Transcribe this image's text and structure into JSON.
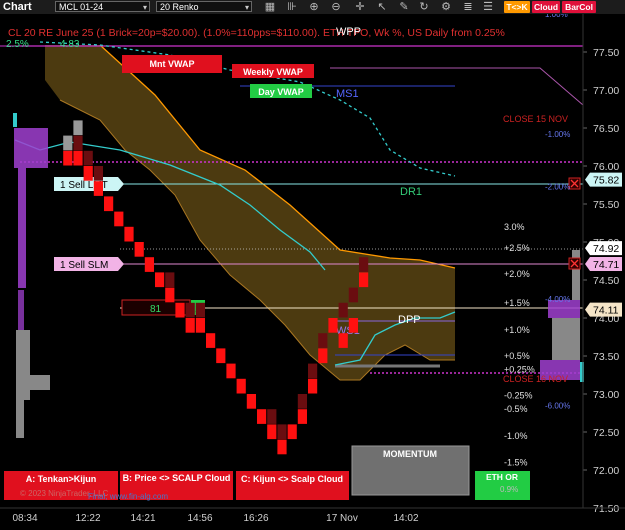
{
  "toolbar": {
    "title": "Chart",
    "symbol": "MCL 01-24",
    "period": "20 Renko",
    "icons": [
      "grid-icon",
      "zoom-in-icon",
      "zoom-out-icon",
      "crosshair-icon",
      "cursor-icon",
      "pencil-icon",
      "reload-icon",
      "settings-icon",
      "stack-icon",
      "list-icon"
    ],
    "buttons": [
      {
        "label": "T<>K",
        "color": "#ff9900"
      },
      {
        "label": "Cloud",
        "color": "#e0103a"
      },
      {
        "label": "BarCol",
        "color": "#e0103a"
      }
    ]
  },
  "chart_data": {
    "type": "renko",
    "header": "CL 20 RE June 25 (1 Brick=20p=$20.00). (1.0%=110pps=$110.00). ETH TPO, Wk %, US Daily from 0.25%",
    "top_left_values": [
      "2.5%",
      "4.83"
    ],
    "ylim": [
      71.5,
      78.0
    ],
    "y_ticks": [
      71.5,
      72.0,
      72.5,
      73.0,
      73.5,
      74.0,
      74.5,
      75.0,
      75.5,
      76.0,
      76.5,
      77.0,
      77.5
    ],
    "x_tick_labels": [
      "08:34",
      "12:22",
      "14:21",
      "14:56",
      "16:26",
      "17 Nov",
      "14:02"
    ],
    "bricks": {
      "red": [
        [
          1,
          76.2
        ],
        [
          2,
          76.2
        ],
        [
          3,
          76.0
        ],
        [
          4,
          75.8
        ],
        [
          5,
          75.6
        ],
        [
          6,
          75.4
        ],
        [
          7,
          75.2
        ],
        [
          8,
          75.0
        ],
        [
          9,
          74.8
        ],
        [
          10,
          74.6
        ],
        [
          11,
          74.4
        ],
        [
          12,
          74.2
        ],
        [
          13,
          74.0
        ],
        [
          14,
          74.0
        ],
        [
          15,
          73.8
        ],
        [
          16,
          73.6
        ],
        [
          17,
          73.4
        ],
        [
          18,
          73.2
        ],
        [
          19,
          73.0
        ],
        [
          20,
          72.8
        ],
        [
          21,
          72.6
        ],
        [
          22,
          72.4
        ],
        [
          23,
          72.6
        ],
        [
          24,
          72.8
        ],
        [
          25,
          73.2
        ],
        [
          26,
          73.6
        ],
        [
          27,
          74.0
        ],
        [
          28,
          73.8
        ],
        [
          29,
          74.0
        ],
        [
          30,
          74.6
        ]
      ],
      "dark_red": [
        [
          2,
          76.4
        ],
        [
          3,
          76.2
        ],
        [
          4,
          76.0
        ],
        [
          11,
          74.6
        ],
        [
          13,
          74.2
        ],
        [
          14,
          74.2
        ],
        [
          21,
          72.8
        ],
        [
          22,
          72.6
        ],
        [
          24,
          73.0
        ],
        [
          25,
          73.4
        ],
        [
          26,
          73.8
        ],
        [
          28,
          74.2
        ],
        [
          29,
          74.4
        ],
        [
          30,
          74.8
        ]
      ],
      "top_row": [
        [
          1,
          76.4
        ],
        [
          2,
          76.6
        ]
      ]
    },
    "series": [
      {
        "name": "Mnt VWAP",
        "values": [
          [
            0,
            77.5
          ],
          [
            10,
            77.5
          ],
          [
            13,
            77.4
          ]
        ]
      },
      {
        "name": "Weekly VWAP",
        "values": [
          [
            15,
            77.35
          ],
          [
            19,
            77.35
          ],
          [
            20,
            77.25
          ]
        ]
      },
      {
        "name": "Day VWAP",
        "values": [
          [
            15,
            77.1
          ],
          [
            19,
            77.1
          ]
        ]
      }
    ],
    "levels": [
      {
        "label": "WPP",
        "value": 77.85,
        "color": "#ffffff"
      },
      {
        "label": "MS1",
        "value": 77.15,
        "color": "#5566ff"
      },
      {
        "label": "DR1",
        "value": 75.82,
        "color": "#33cc77"
      },
      {
        "label": "WS1",
        "value": 73.7,
        "color": "#9977ee"
      },
      {
        "label": "DPP",
        "value": 74.0,
        "color": "#ffffff"
      },
      {
        "label": "CLOSE 15 NOV",
        "value": 76.6,
        "color": "#cc2222"
      },
      {
        "label": "CLOSE 16 NOV",
        "value": 73.15,
        "color": "#cc2222"
      }
    ],
    "pct_labels": [
      {
        "text": "3.0%",
        "value": 75.2
      },
      {
        "text": "+2.5%",
        "value": 74.92
      },
      {
        "text": "+2.0%",
        "value": 74.58
      },
      {
        "text": "+1.5%",
        "value": 74.2
      },
      {
        "text": "+1.0%",
        "value": 73.84
      },
      {
        "text": "+0.5%",
        "value": 73.5
      },
      {
        "text": "+0.25%",
        "value": 73.32
      },
      {
        "text": "-0.25%",
        "value": 72.98
      },
      {
        "text": "-0.5%",
        "value": 72.8
      },
      {
        "text": "-1.0%",
        "value": 72.45
      },
      {
        "text": "-1.5%",
        "value": 72.1
      }
    ],
    "weekly_pct": [
      {
        "text": "1.00%",
        "value": 78.0
      },
      {
        "text": "-1.00%",
        "value": 76.42
      },
      {
        "text": "-2.00%",
        "value": 75.73
      },
      {
        "text": "-4.00%",
        "value": 74.25
      },
      {
        "text": "-6.00%",
        "value": 72.85
      }
    ],
    "price_labels": [
      {
        "text": "75.82",
        "value": 75.82,
        "bg": "#ccf5f5",
        "fg": "#000000"
      },
      {
        "text": "74.92",
        "value": 74.92,
        "bg": "#ffffff",
        "fg": "#000000"
      },
      {
        "text": "74.71",
        "value": 74.71,
        "bg": "#f2b3e6",
        "fg": "#000000"
      },
      {
        "text": "74.11",
        "value": 74.11,
        "bg": "#f5e5c8",
        "fg": "#000000"
      }
    ],
    "orders": [
      {
        "text": "1 Sell LMT",
        "value": 75.82,
        "bg": "#ccf5f5",
        "line": "#88e6e6"
      },
      {
        "text": "1 Sell SLM",
        "value": 74.71,
        "bg": "#f2b3e6",
        "line": "#e088d0"
      }
    ],
    "position": {
      "qty": "81",
      "size": "1",
      "value": 74.11
    }
  },
  "panels": [
    {
      "label": "A: Tenkan>Kijun",
      "color": "#e0101e"
    },
    {
      "label": "B: Price <> SCALP Cloud",
      "color": "#e0101e"
    },
    {
      "label": "C: Kijun <> Scalp Cloud",
      "color": "#e0101e"
    },
    {
      "label": "MOMENTUM",
      "color": "#707070"
    },
    {
      "label": "ETH OR",
      "color": "#22cc44"
    }
  ],
  "footer": {
    "copyright": "© 2023 NinjaTrader, LLC",
    "website": "Final, www.fin-alg.com",
    "pct": "0.9%"
  },
  "colors": {
    "bull_cloud": "#8a6a1e",
    "bear_line": "#ff9900",
    "tenkan": "#33cccc",
    "kijun_dash": "#33cccc",
    "profile": "#a040d0",
    "profile_gray": "#888888"
  }
}
